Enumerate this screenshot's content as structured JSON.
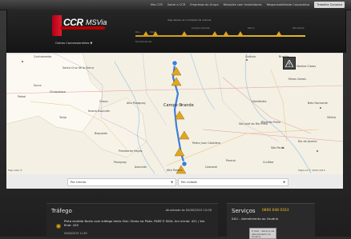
{
  "topnav": {
    "items": [
      "Mia CCR",
      "Sobre a CCR",
      "Empresas do Grupo",
      "Relações com Investidores",
      "Responsabilidade Corporativa",
      "Trabalhe Conosco"
    ],
    "active_index": 5
  },
  "header": {
    "logo_text_1": "CCR",
    "logo_text_2": "MSVia",
    "hotlink": "Outras Concessionárias ▼",
    "route_caption": "Veja abaixo as condições da rodovia",
    "route_labels": [
      "Rio...",
      "São...",
      "Campo Grande",
      "Morro",
      "São Paulo",
      "Rondonópolis"
    ]
  },
  "map": {
    "places": [
      "Cochabamba",
      "Santa Cruz de la Sierra",
      "Sucre",
      "Potosí",
      "Tarija",
      "Chuquisaca",
      "Chaco",
      "Alto Paraguay",
      "Boquerón",
      "Nueva Asunción",
      "Presidente Hayes",
      "Asunción",
      "Campo Grande",
      "Pedro Juan Caballero",
      "Goiânia",
      "Brasília",
      "Minas Gerais",
      "Montes Claros",
      "Belo Horizonte",
      "Vitória",
      "Rio de Janeiro",
      "São Paulo",
      "Curitiba",
      "Paraná",
      "São José do Rio Preto",
      "Ribeirão Preto",
      "Uberlândia",
      "Cascavel",
      "Alto Paraná",
      "Paraguay"
    ],
    "copyright": "MapLink © 2005-2015",
    "attribution": "Map data ©"
  },
  "controls": {
    "left_select": "Por trecho",
    "right_select": "Por cidade"
  },
  "traffic": {
    "title": "Tráfego",
    "updated": "Atualizado às 00/00/2015 12:00",
    "message": "Pista sentido Norte com tráfego lento Obs: Obras na Pista. PARE E SIGA. km inicial: 421 / km final: 425",
    "date": "00/00/2015 11:49"
  },
  "services": {
    "title": "Serviços",
    "phone": "0800 648 0163",
    "sau_label": "SAU – Atendimento ao Usuário",
    "sau_box_line1": "0 SAU – Serviço de",
    "sau_box_line2": "Atendimento ao Usuário"
  }
}
